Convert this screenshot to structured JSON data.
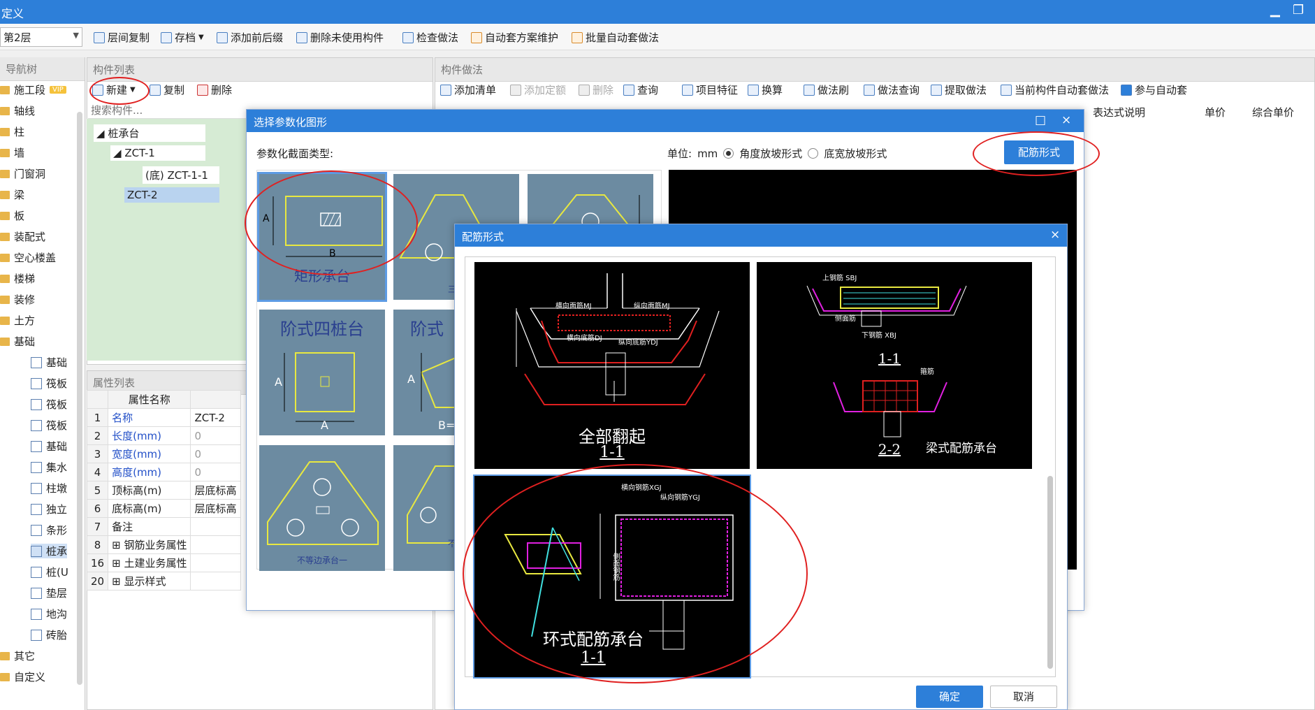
{
  "titlebar": {
    "title": "定义",
    "min": "▁",
    "restore": "❐"
  },
  "toolbar": {
    "floor": "第2层",
    "items": [
      "层间复制",
      "存档",
      "添加前后缀",
      "删除未使用构件",
      "检查做法",
      "自动套方案维护",
      "批量自动套做法"
    ]
  },
  "nav": {
    "title": "导航树",
    "items": [
      "施工段",
      "轴线",
      "柱",
      "墙",
      "门窗洞",
      "梁",
      "板",
      "装配式",
      "空心楼盖",
      "楼梯",
      "装修",
      "土方",
      "基础"
    ],
    "vip": "VIP",
    "sub": [
      "基础",
      "筏板",
      "筏板",
      "筏板",
      "基础",
      "集水",
      "柱墩",
      "独立",
      "条形",
      "桩承",
      "桩(U",
      "垫层",
      "地沟",
      "砖胎"
    ],
    "tail": [
      "其它",
      "自定义"
    ]
  },
  "complist": {
    "title": "构件列表",
    "new": "新建",
    "copy": "复制",
    "delete": "删除",
    "search_placeholder": "搜索构件...",
    "tree": [
      "桩承台",
      "ZCT-1",
      "(底) ZCT-1-1",
      "ZCT-2"
    ]
  },
  "props": {
    "title": "属性列表",
    "header": "属性名称",
    "rows": [
      {
        "n": "1",
        "name": "名称",
        "val": "ZCT-2"
      },
      {
        "n": "2",
        "name": "长度(mm)",
        "val": "0"
      },
      {
        "n": "3",
        "name": "宽度(mm)",
        "val": "0"
      },
      {
        "n": "4",
        "name": "高度(mm)",
        "val": "0"
      },
      {
        "n": "5",
        "name": "顶标高(m)",
        "val": "层底标高"
      },
      {
        "n": "6",
        "name": "底标高(m)",
        "val": "层底标高"
      },
      {
        "n": "7",
        "name": "备注",
        "val": ""
      },
      {
        "n": "8",
        "name": "钢筋业务属性",
        "val": ""
      },
      {
        "n": "16",
        "name": "土建业务属性",
        "val": ""
      },
      {
        "n": "20",
        "name": "显示样式",
        "val": ""
      }
    ]
  },
  "method": {
    "title": "构件做法",
    "tools": [
      "添加清单",
      "添加定额",
      "删除",
      "查询",
      "项目特征",
      "换算",
      "做法刷",
      "做法查询",
      "提取做法",
      "当前构件自动套做法",
      "参与自动套"
    ],
    "cols": [
      "表达式说明",
      "单价",
      "综合单价"
    ]
  },
  "dlg1": {
    "title": "选择参数化图形",
    "type_label": "参数化截面类型:",
    "unit_label": "单位:",
    "unit": "mm",
    "radio1": "角度放坡形式",
    "radio2": "底宽放坡形式",
    "rebar_btn": "配筋形式",
    "thumbs": [
      "矩形承台",
      "三桩",
      "",
      "阶式四桩台",
      "阶式",
      "",
      "不等边承台一",
      "不等"
    ],
    "dimA": "A",
    "dimB": "B",
    "dimBeq": "B="
  },
  "dlg2": {
    "title": "配筋形式",
    "close": "×",
    "opt1": {
      "caption": "全部翻起",
      "sect": "1-1",
      "labels": [
        "横向面筋MJ",
        "纵向面筋MJ",
        "横向底筋DJ",
        "纵向底筋YDJ"
      ]
    },
    "opt2": {
      "caption": "梁式配筋承台",
      "sect1": "1-1",
      "sect2": "2-2",
      "labels": [
        "上钢筋 SBJ",
        "侧面筋",
        "下钢筋 XBJ",
        "箍筋"
      ]
    },
    "opt3": {
      "caption": "环式配筋承台",
      "sect": "1-1",
      "labels": [
        "横向钢筋XGJ",
        "纵向钢筋YGJ",
        "侧面钢筋"
      ]
    },
    "ok": "确定",
    "cancel": "取消"
  }
}
